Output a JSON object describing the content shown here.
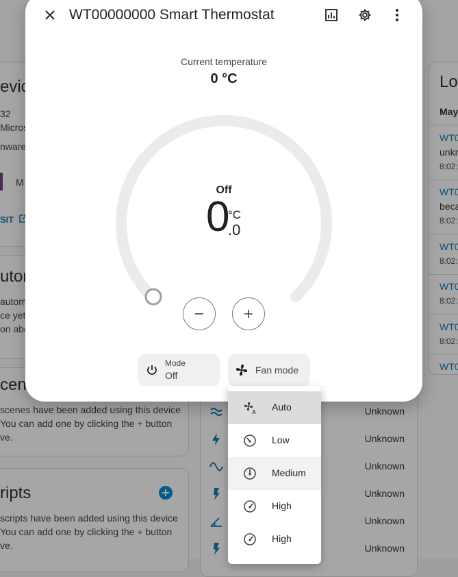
{
  "dialog": {
    "title": "WT00000000 Smart Thermostat",
    "current_label": "Current temperature",
    "current_value": "0 °C",
    "dial": {
      "state": "Off",
      "integer": "0",
      "unit": "°C",
      "decimal": ".0"
    },
    "mode_chip": {
      "label": "Mode",
      "value": "Off"
    },
    "fan_chip": {
      "label": "Fan mode"
    }
  },
  "fan_menu": {
    "items": [
      {
        "label": "Auto",
        "selected": true
      },
      {
        "label": "Low",
        "selected": false
      },
      {
        "label": "Medium",
        "selected": false,
        "hovered": true
      },
      {
        "label": "High",
        "selected": false
      },
      {
        "label": "High",
        "selected": false
      }
    ]
  },
  "background": {
    "device_card": {
      "title_fragment": "evice",
      "line1": "32",
      "line2": "Microso",
      "line3": "nware:",
      "mfr_fragment": "M",
      "visit_label": "SIT"
    },
    "automations_card": {
      "title_fragment": "utom",
      "text1": "autom",
      "text2": "ce yet",
      "text3": "on abo"
    },
    "scenes_card": {
      "title_fragment": "cenes",
      "text1": "scenes have been added using this device",
      "text2": "You can add one by clicking the + button",
      "text3": "ve."
    },
    "scripts_card": {
      "title_fragment": "ripts",
      "text1": "scripts have been added using this device",
      "text2": "You can add one by clicking the + button",
      "text3": "ve."
    },
    "logbook": {
      "title_fragment": "Lo",
      "date_fragment": "May",
      "rows": [
        {
          "name": "WT0",
          "text": "unkn",
          "time": "8:02:"
        },
        {
          "name": "WT0",
          "text": "beca",
          "time": "8:02:"
        },
        {
          "name": "WT0",
          "time": "8:02:"
        },
        {
          "name": "WT0",
          "time": "8:02:"
        },
        {
          "name": "WT0",
          "time": "8:02:"
        },
        {
          "name": "WT0"
        }
      ]
    },
    "entity_states": [
      "Unknown",
      "Unknown",
      "Unknown",
      "Unknown",
      "Unknown",
      "Unknown"
    ]
  },
  "colors": {
    "accent": "#03a9f4",
    "dial_track": "#ebebeb",
    "chip_bg": "#f0f0f0"
  }
}
